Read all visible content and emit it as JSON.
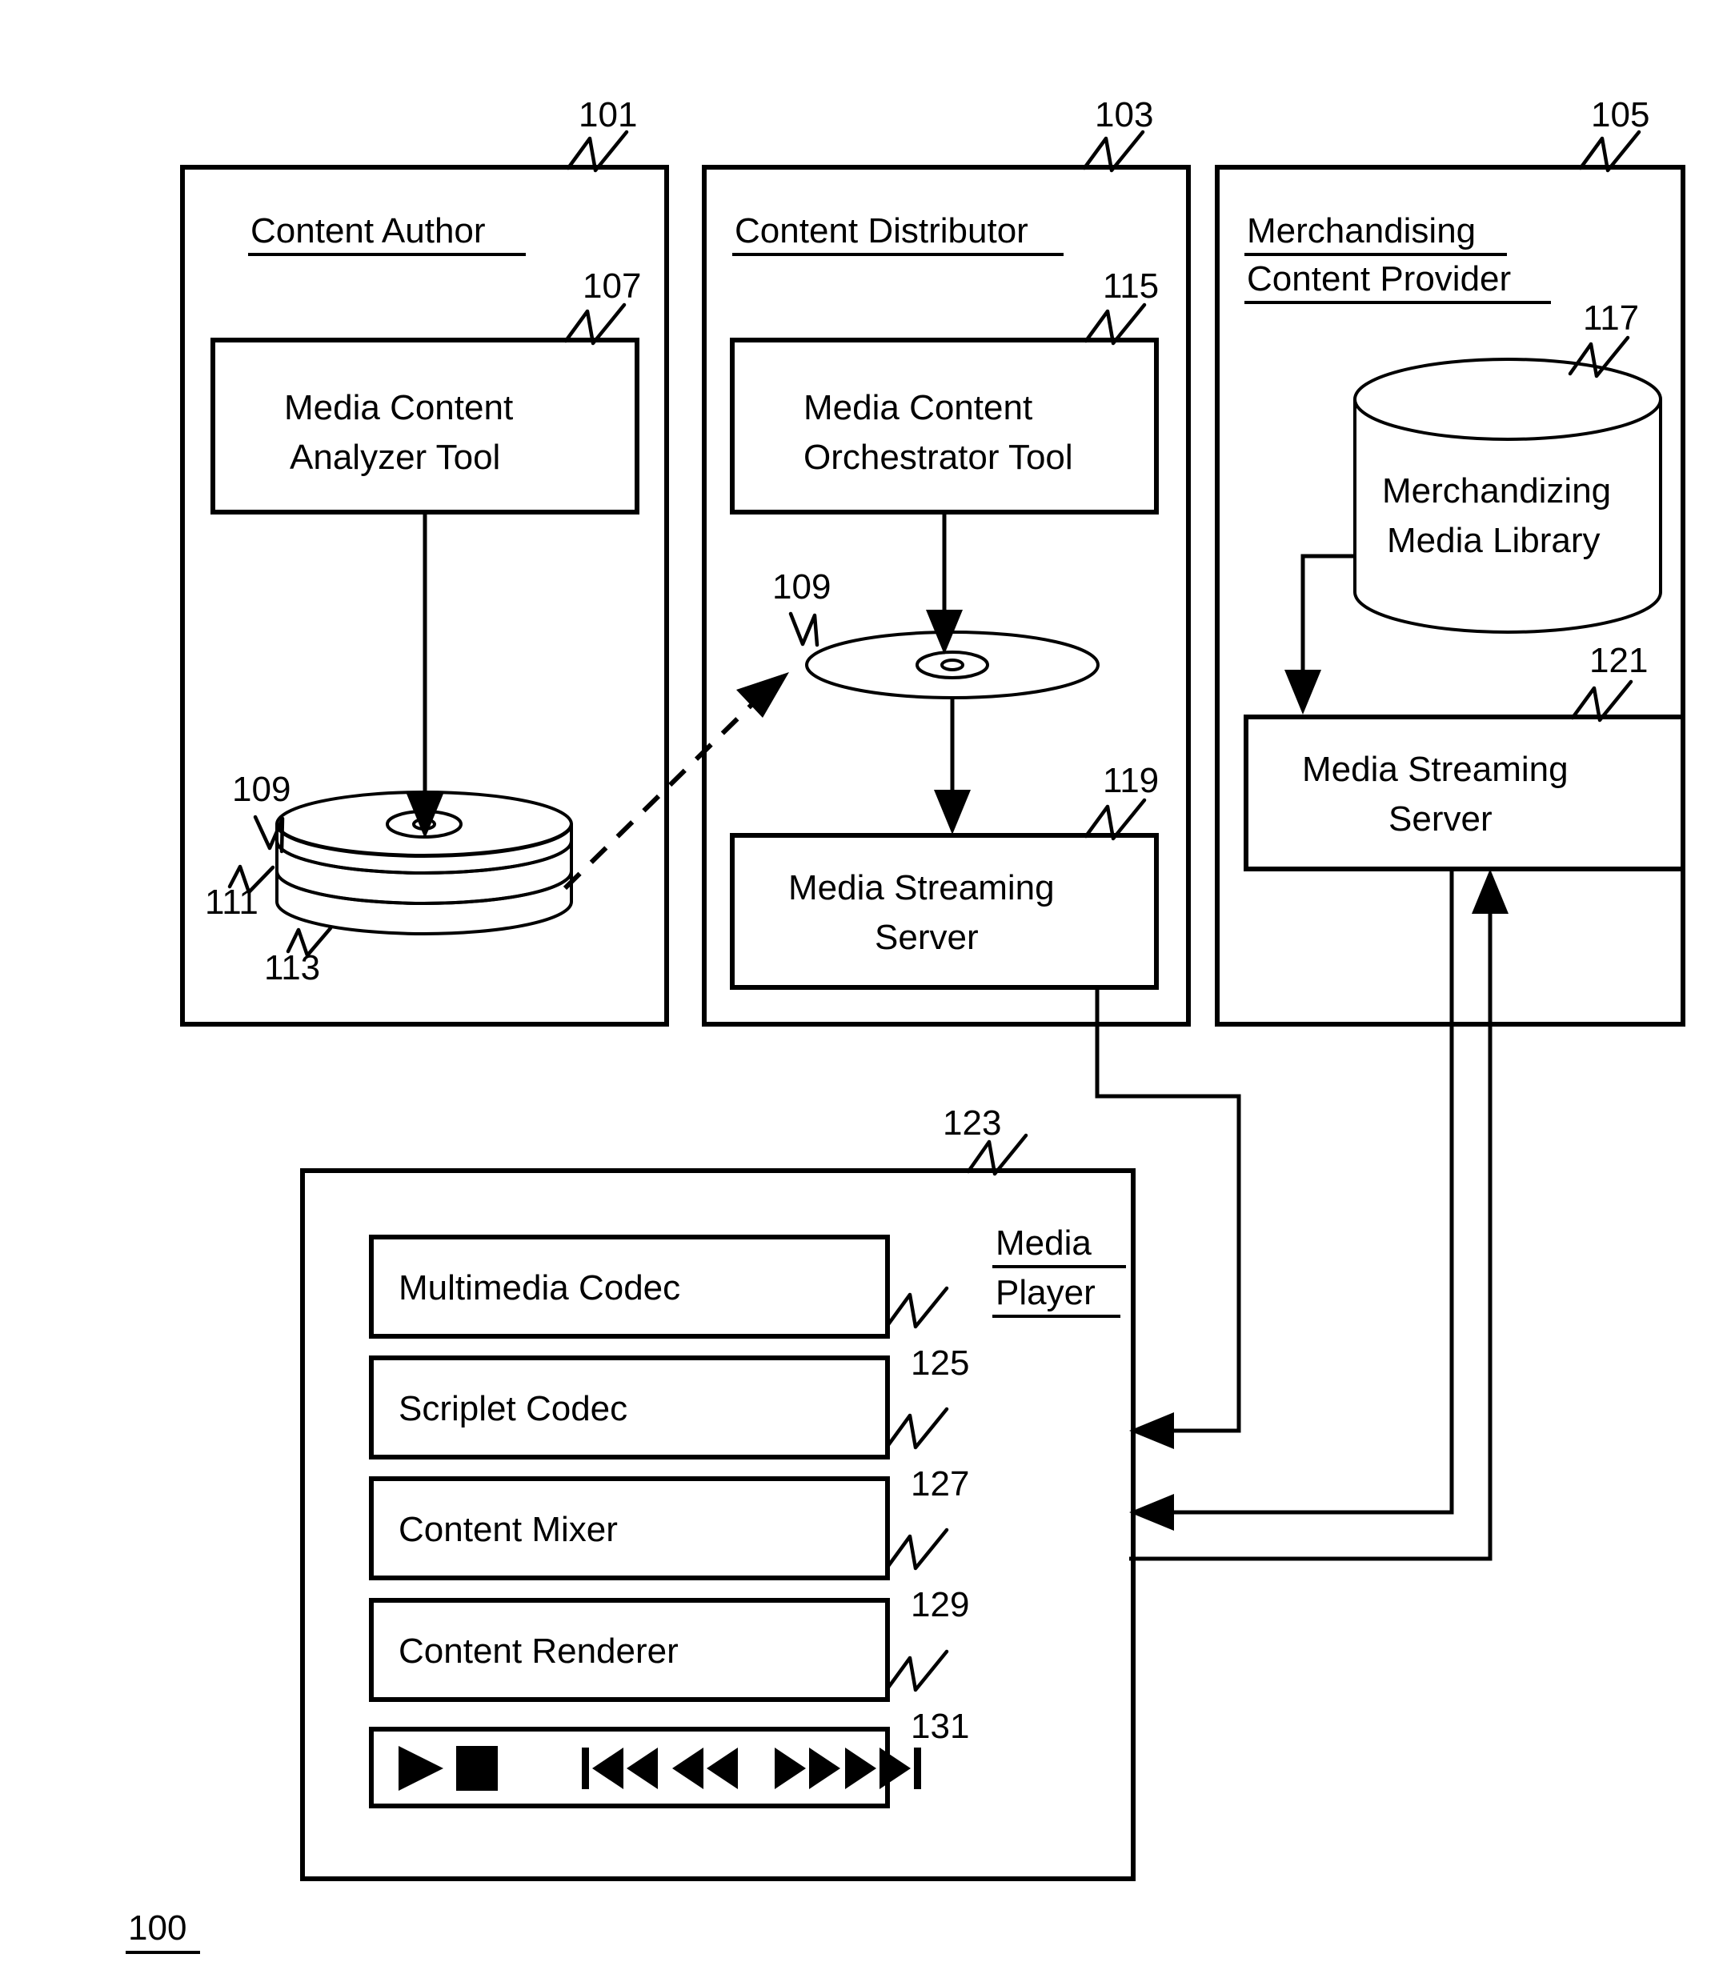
{
  "figure": {
    "number": "100"
  },
  "panels": [
    {
      "id": "content-author",
      "ref": "101",
      "title": "Content Author",
      "tool": {
        "ref": "107",
        "line1": "Media Content",
        "line2": "Analyzer Tool"
      },
      "disc_stack": {
        "refs": [
          "109",
          "111",
          "113"
        ]
      }
    },
    {
      "id": "content-distributor",
      "ref": "103",
      "title": "Content Distributor",
      "tool": {
        "ref": "115",
        "line1": "Media Content",
        "line2": "Orchestrator Tool"
      },
      "disc": {
        "ref": "109"
      },
      "server": {
        "ref": "119",
        "line1": "Media Streaming",
        "line2": "Server"
      }
    },
    {
      "id": "merchandising-content-provider",
      "ref": "105",
      "title_line1": "Merchandising",
      "title_line2": "Content Provider",
      "library": {
        "ref": "117",
        "line1": "Merchandizing",
        "line2": "Media Library"
      },
      "server": {
        "ref": "121",
        "line1": "Media Streaming",
        "line2": "Server"
      }
    }
  ],
  "media_player": {
    "ref": "123",
    "title_line1": "Media",
    "title_line2": "Player",
    "components": [
      {
        "ref": "125",
        "label": "Multimedia Codec"
      },
      {
        "ref": "127",
        "label": "Scriplet Codec"
      },
      {
        "ref": "129",
        "label": "Content Mixer"
      },
      {
        "ref": "131",
        "label": "Content Renderer"
      }
    ],
    "transport_controls": [
      {
        "name": "play-icon",
        "glyph": "play"
      },
      {
        "name": "stop-icon",
        "glyph": "stop"
      },
      {
        "name": "skip-previous-icon",
        "glyph": "skip-prev"
      },
      {
        "name": "rewind-icon",
        "glyph": "rewind"
      },
      {
        "name": "fast-forward-icon",
        "glyph": "fast-forward"
      },
      {
        "name": "skip-next-icon",
        "glyph": "skip-next"
      }
    ]
  },
  "colors": {
    "ink": "#000000",
    "paper": "#ffffff"
  }
}
